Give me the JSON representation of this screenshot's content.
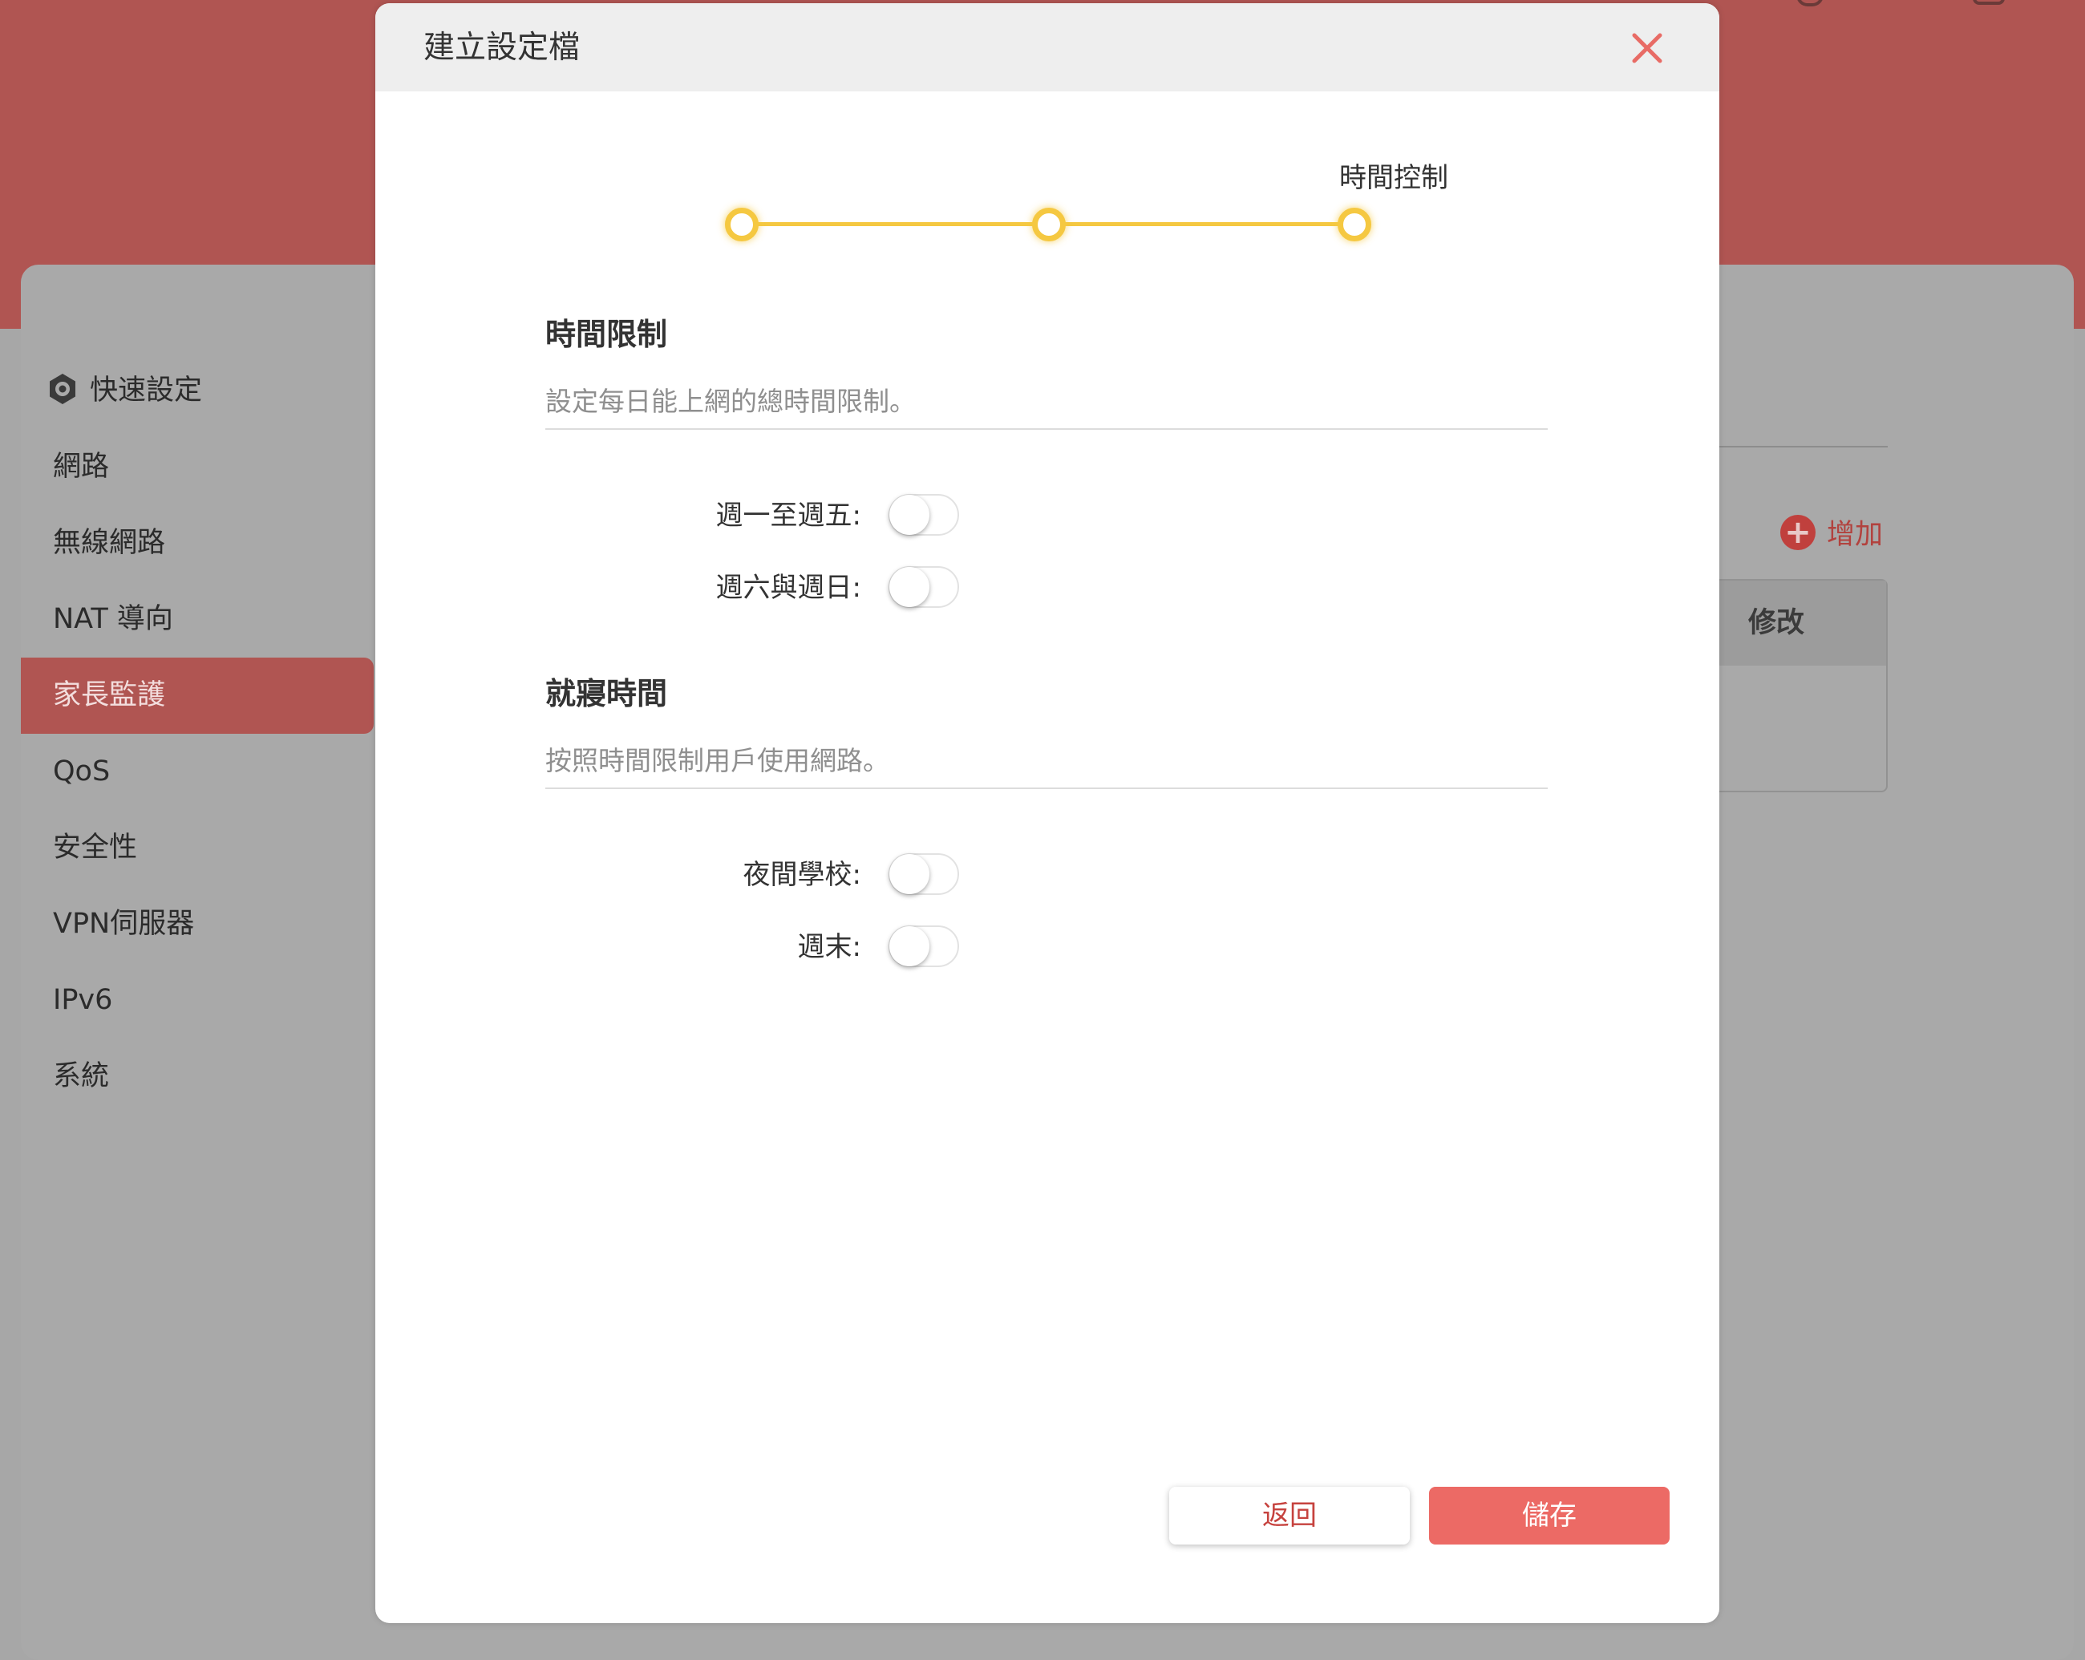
{
  "sidebar": {
    "items": [
      {
        "label": "快速設定",
        "icon": "gear-icon"
      },
      {
        "label": "網路"
      },
      {
        "label": "無線網路"
      },
      {
        "label": "NAT 導向"
      },
      {
        "label": "家長監護",
        "active": true
      },
      {
        "label": "QoS"
      },
      {
        "label": "安全性"
      },
      {
        "label": "VPN伺服器"
      },
      {
        "label": "IPv6"
      },
      {
        "label": "系統"
      }
    ]
  },
  "background": {
    "add_label": "增加",
    "table_header_edit": "修改"
  },
  "modal": {
    "title": "建立設定檔",
    "stepper": {
      "current_label": "時間控制",
      "steps_total": 3,
      "current_step": 3
    },
    "time_limit": {
      "title": "時間限制",
      "description": "設定每日能上網的總時間限制。",
      "toggles": [
        {
          "label": "週一至週五:",
          "on": false
        },
        {
          "label": "週六與週日:",
          "on": false
        }
      ]
    },
    "bedtime": {
      "title": "就寢時間",
      "description": "按照時間限制用戶使用網路。",
      "toggles": [
        {
          "label": "夜間學校:",
          "on": false
        },
        {
          "label": "週末:",
          "on": false
        }
      ]
    },
    "buttons": {
      "back": "返回",
      "save": "儲存"
    }
  },
  "colors": {
    "brand": "#b05552",
    "accent_button": "#ec6a65",
    "stepper": "#f5c841",
    "close": "#e86b65"
  }
}
